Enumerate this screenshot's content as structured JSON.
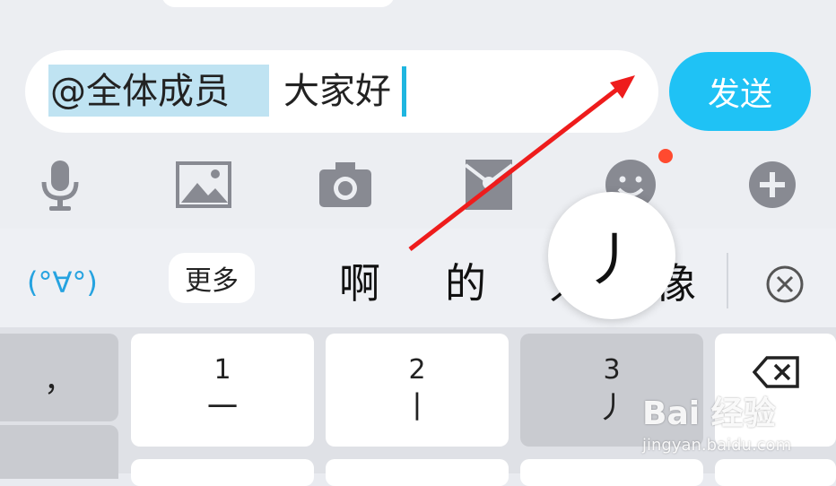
{
  "composer": {
    "mention": "@全体成员",
    "message": "大家好",
    "send_label": "发送"
  },
  "toolbar": {
    "icons": [
      "microphone-icon",
      "image-icon",
      "camera-icon",
      "red-packet-icon",
      "emoji-icon",
      "plus-icon"
    ],
    "badge": "new"
  },
  "candidates": {
    "emoticon": "(°∀°)",
    "more_label": "更多",
    "items": [
      "啊",
      "的",
      "只",
      "像"
    ]
  },
  "popup": {
    "char": "丿"
  },
  "keyboard": {
    "comma": "，",
    "keys": [
      {
        "num": "1",
        "stroke": "一"
      },
      {
        "num": "2",
        "stroke": "丨"
      },
      {
        "num": "3",
        "stroke": "丿"
      }
    ]
  },
  "watermark": {
    "brand": "Bai 经验",
    "url": "jingyan.baidu.com"
  },
  "colors": {
    "accent": "#1fc2f5",
    "arrow": "#ee1c1c",
    "chip": "#bfe3f2",
    "badge": "#ff4a2f"
  }
}
